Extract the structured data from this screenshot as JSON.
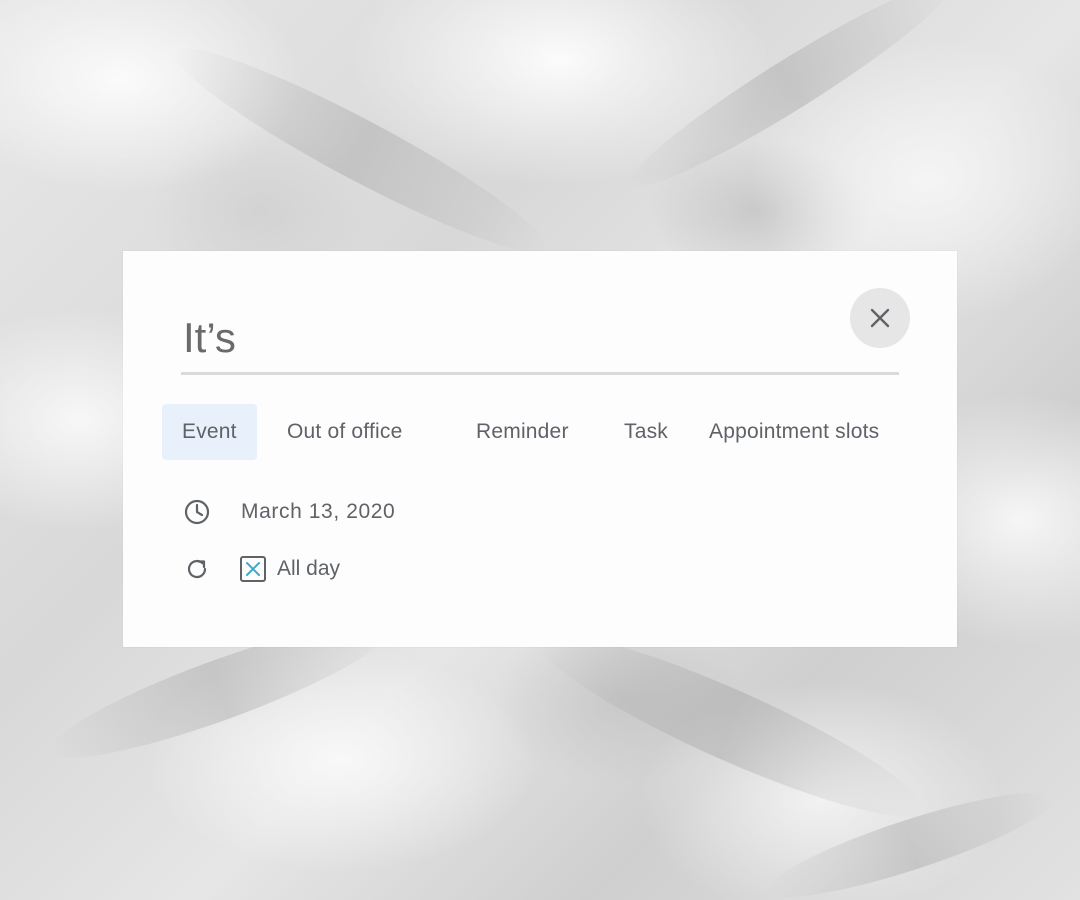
{
  "dialog": {
    "title_value": "It’s",
    "close_label": "Close"
  },
  "tabs": [
    {
      "label": "Event",
      "active": true
    },
    {
      "label": "Out of office",
      "active": false
    },
    {
      "label": "Reminder",
      "active": false
    },
    {
      "label": "Task",
      "active": false
    },
    {
      "label": "Appointment slots",
      "active": false
    }
  ],
  "details": {
    "date": "March 13, 2020",
    "all_day_label": "All day",
    "all_day_checked": true
  },
  "icons": {
    "close": "close-icon",
    "date": "clock-icon",
    "repeat": "refresh-icon",
    "checkbox_mark": "x-mark-icon"
  },
  "colors": {
    "active_tab_bg": "#e8f0fb",
    "checkbox_mark": "#3fa9c9",
    "text": "#5f6368"
  }
}
